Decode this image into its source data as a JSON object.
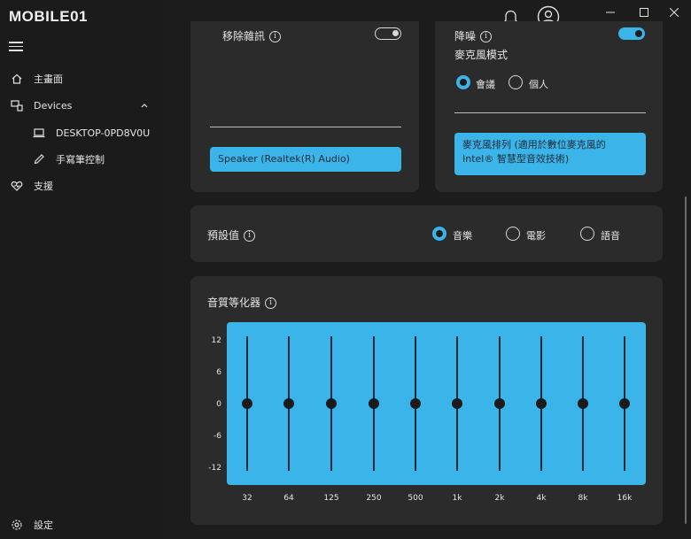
{
  "app": {
    "logo_text": "MOBILE01"
  },
  "sidebar": {
    "items": [
      {
        "label": "主畫面",
        "icon": "home-icon"
      },
      {
        "label": "Devices",
        "icon": "devices-icon"
      },
      {
        "label": "DESKTOP-0PD8V0U",
        "icon": "laptop-icon"
      },
      {
        "label": "手寫筆控制",
        "icon": "pen-icon"
      },
      {
        "label": "支援",
        "icon": "heart-support-icon"
      }
    ],
    "settings_label": "設定"
  },
  "left_card": {
    "title": "移除雜訊",
    "device_button": "Speaker (Realtek(R) Audio)"
  },
  "right_card": {
    "noise_label": "降噪",
    "mic_mode_label": "麥克風模式",
    "mode_options": [
      "會議",
      "個人"
    ],
    "mode_selected": "會議",
    "mic_array_button": "麥克風排列 (適用於數位麥克風的 Intel® 智慧型音效技術)"
  },
  "preset": {
    "label": "預設值",
    "options": [
      "音樂",
      "電影",
      "語音"
    ],
    "selected": "音樂"
  },
  "equalizer": {
    "title": "音質等化器",
    "y_ticks": [
      "12",
      "6",
      "0",
      "-6",
      "-12"
    ],
    "bands": [
      "32",
      "64",
      "125",
      "250",
      "500",
      "1k",
      "2k",
      "4k",
      "8k",
      "16k"
    ],
    "band_values": [
      0,
      0,
      0,
      0,
      0,
      0,
      0,
      0,
      0,
      0
    ],
    "range": [
      -12,
      12
    ]
  },
  "colors": {
    "accent": "#3bb4ea",
    "bg": "#1c1c1c",
    "card": "#2b2b2b"
  }
}
